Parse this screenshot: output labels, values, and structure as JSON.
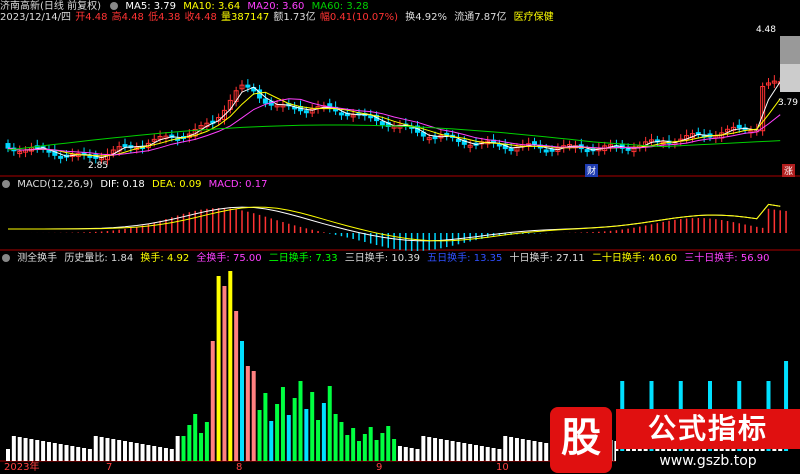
{
  "header": {
    "stock": "济南高新(日线 前复权)",
    "ma5": "MA5: 3.79",
    "ma10": "MA10: 3.64",
    "ma20": "MA20: 3.60",
    "ma60": "MA60: 3.28"
  },
  "info": {
    "date": "2023/12/14/四",
    "open": "开4.48",
    "high": "高4.48",
    "low": "低4.38",
    "close": "收4.48",
    "vol": "量387147",
    "amount": "额1.73亿",
    "change": "幅0.41(10.07%)",
    "turnover": "换4.92%",
    "float": "流通7.87亿",
    "sector": "医疗保健"
  },
  "price_labels": {
    "high": "4.48",
    "low": "2.85",
    "right": "3.79",
    "cai": "财",
    "zhang": "涨"
  },
  "macd": {
    "name": "MACD(12,26,9)",
    "dif": "DIF: 0.18",
    "dea": "DEA: 0.09",
    "macd": "MACD: 0.17"
  },
  "turnover_panel": {
    "name": "测全换手",
    "ratio": "历史量比: 1.84",
    "t1": "换手: 4.92",
    "t_all": "全换手: 75.00",
    "t2": "二日换手: 7.33",
    "t3": "三日换手: 10.39",
    "t5": "五日换手: 13.35",
    "t10": "十日换手: 27.11",
    "t20": "二十日换手: 40.60",
    "t30": "三十日换手: 56.90"
  },
  "x_axis": [
    "2023年",
    "7",
    "8",
    "9",
    "10"
  ],
  "watermark": {
    "logo": "股",
    "title": "公式指标",
    "url": "www.gszb.top"
  },
  "colors": {
    "up": "#ff3333",
    "down": "#00d8ff",
    "ma5": "#ffffff",
    "ma10": "#ffff00",
    "ma20": "#ff40ff",
    "ma60": "#00d000"
  }
}
